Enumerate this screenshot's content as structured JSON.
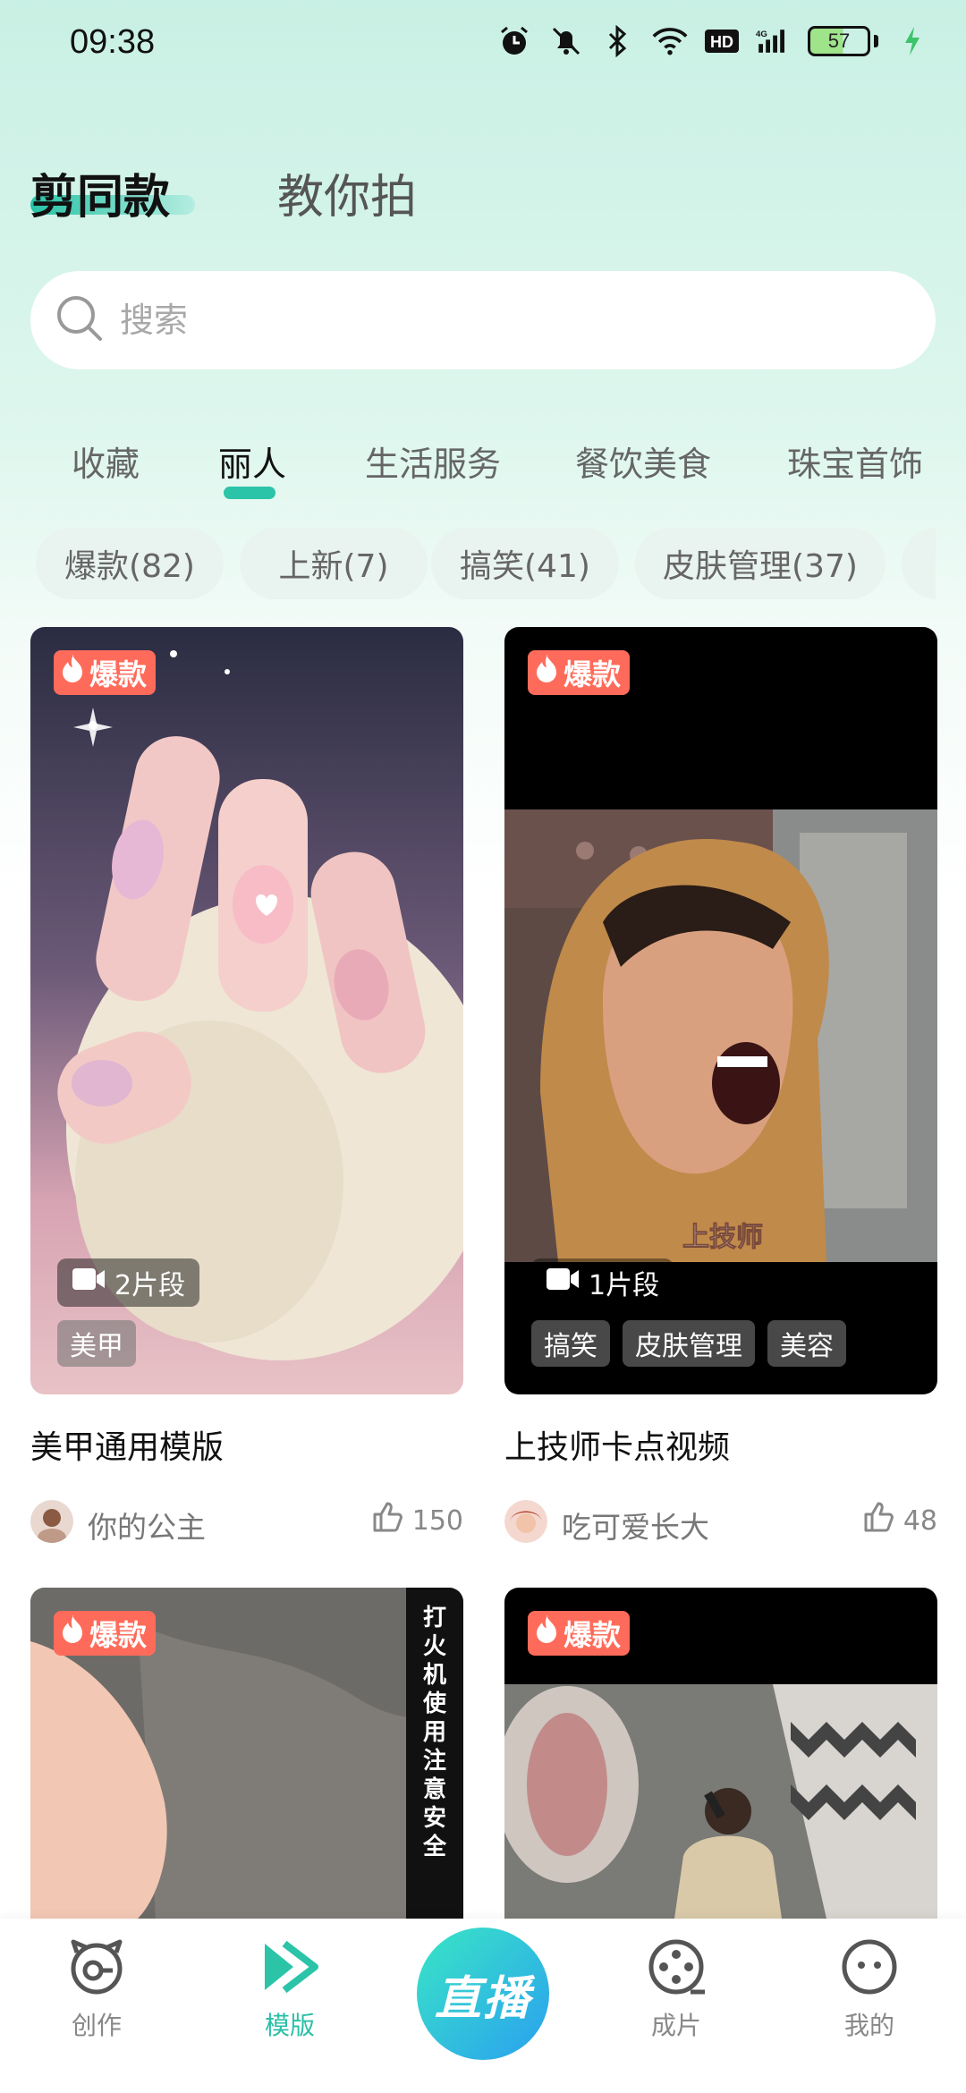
{
  "status_bar": {
    "time": "09:38",
    "battery": "57",
    "network": "HD",
    "icons": [
      "alarm-icon",
      "mute-icon",
      "bluetooth-icon",
      "wifi-icon",
      "hd-icon",
      "signal-4g-icon",
      "battery-icon",
      "charging-icon"
    ]
  },
  "top_tabs": [
    {
      "label": "剪同款",
      "active": true
    },
    {
      "label": "教你拍",
      "active": false
    }
  ],
  "search": {
    "placeholder": "搜索"
  },
  "category_tabs": [
    {
      "label": "收藏",
      "active": false
    },
    {
      "label": "丽人",
      "active": true
    },
    {
      "label": "生活服务",
      "active": false
    },
    {
      "label": "餐饮美食",
      "active": false
    },
    {
      "label": "珠宝首饰",
      "active": false
    }
  ],
  "filter_chips": [
    {
      "label": "爆款(82)"
    },
    {
      "label": "上新(7)"
    },
    {
      "label": "搞笑(41)"
    },
    {
      "label": "皮肤管理(37)"
    }
  ],
  "cards": [
    {
      "badge": "爆款",
      "segments": "2片段",
      "tags": [
        "美甲"
      ],
      "title": "美甲通用模版",
      "author": "你的公主",
      "likes": "150"
    },
    {
      "badge": "爆款",
      "segments": "1片段",
      "tags": [
        "搞笑",
        "皮肤管理",
        "美容"
      ],
      "title": "上技师卡点视频",
      "author": "吃可爱长大",
      "likes": "48",
      "overlay_text": "上技师"
    },
    {
      "badge": "爆款",
      "overlay_text": "打火机使用注意安全"
    },
    {
      "badge": "爆款"
    }
  ],
  "bottom_nav": [
    {
      "label": "创作",
      "icon": "create-icon",
      "active": false
    },
    {
      "label": "模版",
      "icon": "template-icon",
      "active": true
    },
    {
      "label": "直播",
      "icon": "live-icon",
      "active": false
    },
    {
      "label": "成片",
      "icon": "film-reel-icon",
      "active": false
    },
    {
      "label": "我的",
      "icon": "profile-icon",
      "active": false
    }
  ],
  "colors": {
    "accent": "#2bc4a8",
    "hot_badge": "#ff6b5a"
  }
}
